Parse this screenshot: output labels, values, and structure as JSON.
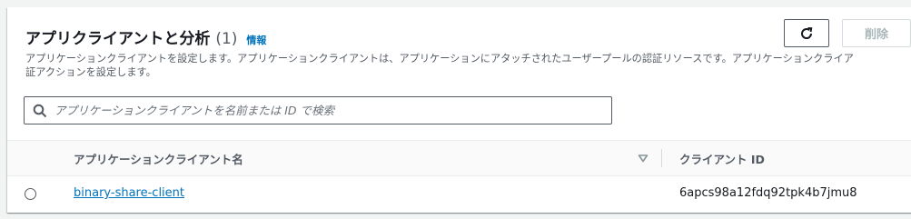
{
  "header": {
    "title": "アプリクライアントと分析",
    "count": "(1)",
    "info_link": "情報",
    "description_line1": "アプリケーションクライアントを設定します。アプリケーションクライアントは、アプリケーションにアタッチされたユーザープールの認証リソースです。アプリケーションクライア",
    "description_line2": "証アクションを設定します。"
  },
  "toolbar": {
    "refresh_icon": "refresh-icon",
    "delete_label": "削除"
  },
  "search": {
    "placeholder": "アプリケーションクライアントを名前または ID で検索",
    "value": ""
  },
  "table": {
    "columns": [
      {
        "label": "アプリケーションクライアント名",
        "sortable": true
      },
      {
        "label": "クライアント ID",
        "sortable": false
      }
    ],
    "rows": [
      {
        "name": "binary-share-client",
        "client_id": "6apcs98a12fdq92tpk4b7jmu8",
        "selected": false
      }
    ]
  },
  "colors": {
    "link": "#0073bb",
    "text": "#16191f",
    "muted": "#545b64",
    "disabled": "#aab7b8"
  }
}
